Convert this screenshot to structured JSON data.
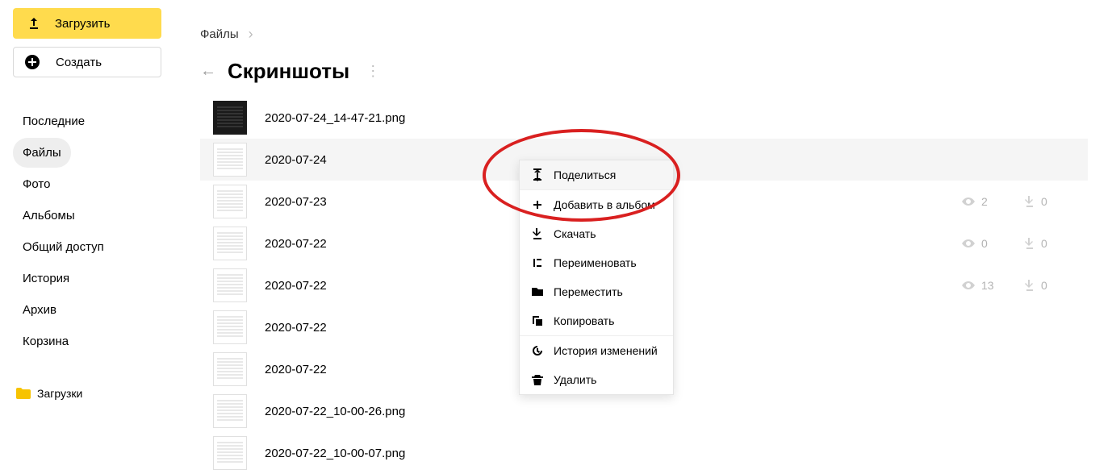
{
  "sidebar": {
    "upload_label": "Загрузить",
    "create_label": "Создать",
    "nav": [
      {
        "label": "Последние"
      },
      {
        "label": "Файлы"
      },
      {
        "label": "Фото"
      },
      {
        "label": "Альбомы"
      },
      {
        "label": "Общий доступ"
      },
      {
        "label": "История"
      },
      {
        "label": "Архив"
      },
      {
        "label": "Корзина"
      }
    ],
    "folders": [
      {
        "label": "Загрузки"
      }
    ]
  },
  "breadcrumb": {
    "root": "Файлы"
  },
  "page_title": "Скриншоты",
  "files": [
    {
      "name": "2020-07-24_14-47-21.png",
      "views": null,
      "downloads": null,
      "dark": true
    },
    {
      "name": "2020-07-24",
      "views": null,
      "downloads": null,
      "dark": false,
      "selected": true
    },
    {
      "name": "2020-07-23",
      "views": "2",
      "downloads": "0",
      "dark": false
    },
    {
      "name": "2020-07-22",
      "views": "0",
      "downloads": "0",
      "dark": false
    },
    {
      "name": "2020-07-22",
      "views": "13",
      "downloads": "0",
      "dark": false
    },
    {
      "name": "2020-07-22",
      "views": null,
      "downloads": null,
      "dark": false
    },
    {
      "name": "2020-07-22",
      "views": null,
      "downloads": null,
      "dark": false
    },
    {
      "name": "2020-07-22_10-00-26.png",
      "views": null,
      "downloads": null,
      "dark": false
    },
    {
      "name": "2020-07-22_10-00-07.png",
      "views": null,
      "downloads": null,
      "dark": false
    }
  ],
  "context_menu": {
    "share": "Поделиться",
    "to_album": "Добавить в альбом",
    "download": "Скачать",
    "rename": "Переименовать",
    "move": "Переместить",
    "copy": "Копировать",
    "history": "История изменений",
    "delete": "Удалить"
  }
}
